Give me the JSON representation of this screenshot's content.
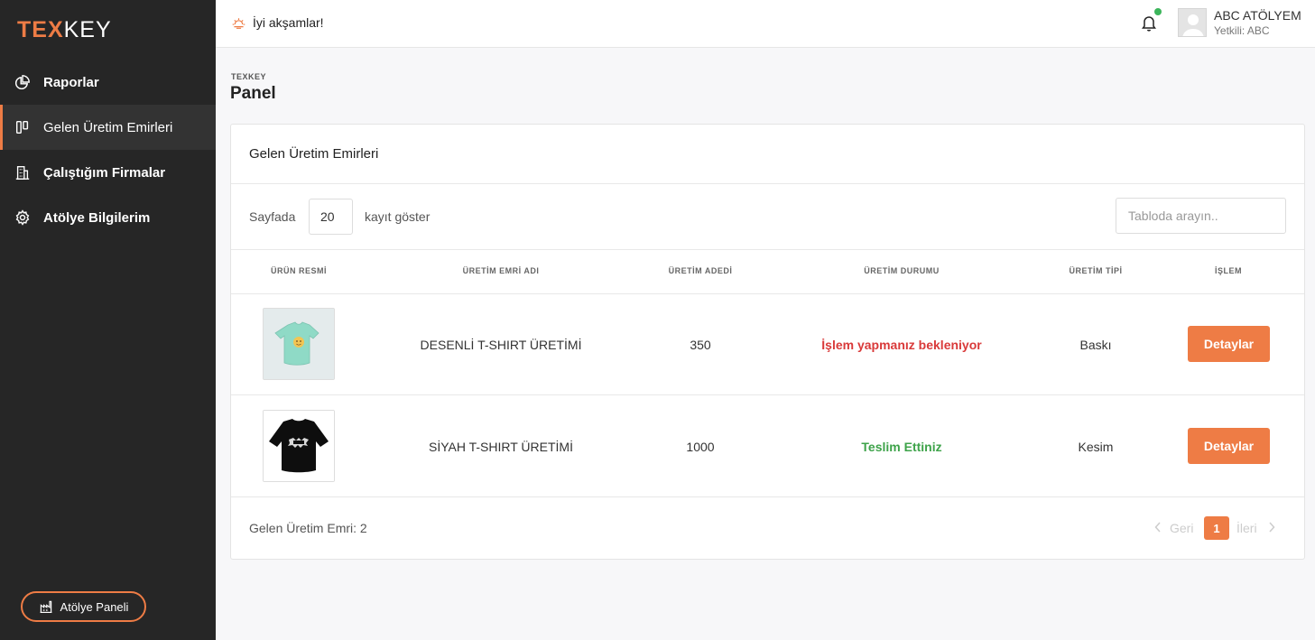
{
  "brand": {
    "part1": "TEX",
    "part2": "KEY",
    "accent_color": "#ee7c45"
  },
  "sidebar": {
    "items": [
      {
        "label": "Raporlar",
        "icon": "pie-chart-icon"
      },
      {
        "label": "Gelen Üretim Emirleri",
        "icon": "columns-icon",
        "active": true
      },
      {
        "label": "Çalıştığım Firmalar",
        "icon": "building-icon"
      },
      {
        "label": "Atölye Bilgilerim",
        "icon": "gear-icon"
      }
    ],
    "bottom_button": "Atölye Paneli"
  },
  "topbar": {
    "greeting": "İyi akşamlar!",
    "user_name": "ABC ATÖLYEM",
    "user_role": "Yetkili: ABC"
  },
  "page": {
    "breadcrumb": "TEXKEY",
    "title": "Panel"
  },
  "card": {
    "title": "Gelen Üretim Emirleri",
    "per_page_label": "Sayfada",
    "per_page_value": "20",
    "per_page_suffix": "kayıt göster",
    "search_placeholder": "Tabloda arayın..",
    "columns": [
      "ÜRÜN RESMİ",
      "ÜRETİM EMRİ ADI",
      "ÜRETİM ADEDİ",
      "ÜRETİM DURUMU",
      "ÜRETİM TİPİ",
      "İŞLEM"
    ],
    "rows": [
      {
        "name": "DESENLİ T-SHIRT ÜRETİMİ",
        "qty": "350",
        "status": "İşlem yapmanız bekleniyor",
        "status_color": "#d93a3a",
        "type": "Baskı",
        "action": "Detaylar"
      },
      {
        "name": "SİYAH T-SHIRT ÜRETİMİ",
        "qty": "1000",
        "status": "Teslim Ettiniz",
        "status_color": "#3ea34a",
        "type": "Kesim",
        "action": "Detaylar"
      }
    ],
    "footer": {
      "count_text": "Gelen Üretim Emri: 2",
      "prev": "Geri",
      "current_page": "1",
      "next": "İleri"
    }
  }
}
